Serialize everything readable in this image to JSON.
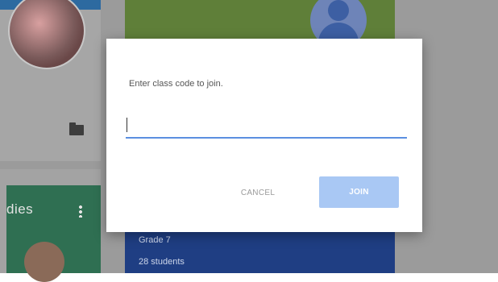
{
  "background": {
    "card_left_title": "dies",
    "card_mid_line1": "Grade 7",
    "card_mid_line2": "28 students"
  },
  "dialog": {
    "prompt": "Enter class code to join.",
    "input_value": "",
    "cancel_label": "CANCEL",
    "join_label": "JOIN"
  },
  "colors": {
    "input_underline": "#5b8fe0",
    "join_button": "#a9c8f4",
    "scrim": "#9b9b9b"
  },
  "icons": [
    "folder-icon",
    "more-vert-icon",
    "profile-icon"
  ]
}
